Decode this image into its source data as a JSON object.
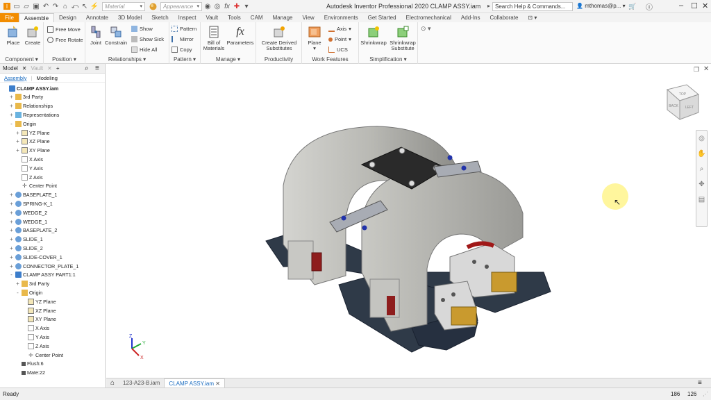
{
  "app": {
    "title": "Autodesk Inventor Professional 2020   CLAMP ASSY.iam",
    "search_placeholder": "Search Help & Commands...",
    "user": "mthomas@p...",
    "material_placeholder": "Material",
    "appearance_placeholder": "Appearance"
  },
  "tabs": [
    "File",
    "Assemble",
    "Design",
    "Annotate",
    "3D Model",
    "Sketch",
    "Inspect",
    "Vault",
    "Tools",
    "CAM",
    "Manage",
    "View",
    "Environments",
    "Get Started",
    "Electromechanical",
    "Add-Ins",
    "Collaborate"
  ],
  "active_tab": "Assemble",
  "ribbon": {
    "component": {
      "label": "Component",
      "place": "Place",
      "create": "Create"
    },
    "position": {
      "label": "Position",
      "free_move": "Free Move",
      "free_rotate": "Free Rotate"
    },
    "relationships": {
      "label": "Relationships",
      "joint": "Joint",
      "constrain": "Constrain",
      "show": "Show",
      "show_sick": "Show Sick",
      "hide_all": "Hide All"
    },
    "pattern": {
      "label": "Pattern",
      "pattern": "Pattern",
      "mirror": "Mirror",
      "copy": "Copy"
    },
    "manage": {
      "label": "Manage",
      "bom_line1": "Bill of",
      "bom_line2": "Materials",
      "parameters": "Parameters"
    },
    "productivity": {
      "label": "Productivity",
      "cds_line1": "Create Derived",
      "cds_line2": "Substitutes"
    },
    "work_features": {
      "label": "Work Features",
      "plane": "Plane",
      "axis": "Axis",
      "point": "Point",
      "ucs": "UCS"
    },
    "simplification": {
      "label": "Simplification",
      "shrinkwrap": "Shrinkwrap",
      "sws_line1": "Shrinkwrap",
      "sws_line2": "Substitute"
    }
  },
  "browser": {
    "tab_model": "Model",
    "tab_vault": "Vault",
    "sub_assembly": "Assembly",
    "sub_modeling": "Modeling",
    "items": [
      {
        "label": "CLAMP ASSY.iam",
        "depth": 0,
        "icon": "asm",
        "exp": "",
        "bold": true
      },
      {
        "label": "3rd Party",
        "depth": 1,
        "icon": "fld",
        "exp": "+"
      },
      {
        "label": "Relationships",
        "depth": 1,
        "icon": "fld",
        "exp": "+"
      },
      {
        "label": "Representations",
        "depth": 1,
        "icon": "rep",
        "exp": "+"
      },
      {
        "label": "Origin",
        "depth": 1,
        "icon": "fld",
        "exp": "-"
      },
      {
        "label": "YZ Plane",
        "depth": 2,
        "icon": "pln",
        "exp": "+"
      },
      {
        "label": "XZ Plane",
        "depth": 2,
        "icon": "pln",
        "exp": "+"
      },
      {
        "label": "XY Plane",
        "depth": 2,
        "icon": "pln",
        "exp": "+"
      },
      {
        "label": "X Axis",
        "depth": 2,
        "icon": "axs",
        "exp": ""
      },
      {
        "label": "Y Axis",
        "depth": 2,
        "icon": "axs",
        "exp": ""
      },
      {
        "label": "Z Axis",
        "depth": 2,
        "icon": "axs",
        "exp": ""
      },
      {
        "label": "Center Point",
        "depth": 2,
        "icon": "pt",
        "exp": ""
      },
      {
        "label": "BASEPLATE_1",
        "depth": 1,
        "icon": "part",
        "exp": "+"
      },
      {
        "label": "SPRING-K_1",
        "depth": 1,
        "icon": "part",
        "exp": "+"
      },
      {
        "label": "WEDGE_2",
        "depth": 1,
        "icon": "part",
        "exp": "+"
      },
      {
        "label": "WEDGE_1",
        "depth": 1,
        "icon": "part",
        "exp": "+"
      },
      {
        "label": "BASEPLATE_2",
        "depth": 1,
        "icon": "part",
        "exp": "+"
      },
      {
        "label": "SLIDE_1",
        "depth": 1,
        "icon": "part",
        "exp": "+"
      },
      {
        "label": "SLIDE_2",
        "depth": 1,
        "icon": "part",
        "exp": "+"
      },
      {
        "label": "SLIDE-COVER_1",
        "depth": 1,
        "icon": "part",
        "exp": "+"
      },
      {
        "label": "CONNECTOR_PLATE_1",
        "depth": 1,
        "icon": "part",
        "exp": "+"
      },
      {
        "label": "CLAMP ASSY PART1:1",
        "depth": 1,
        "icon": "asm",
        "exp": "-"
      },
      {
        "label": "3rd Party",
        "depth": 2,
        "icon": "fld",
        "exp": "+"
      },
      {
        "label": "Origin",
        "depth": 2,
        "icon": "fld",
        "exp": "-"
      },
      {
        "label": "YZ Plane",
        "depth": 3,
        "icon": "pln",
        "exp": ""
      },
      {
        "label": "XZ Plane",
        "depth": 3,
        "icon": "pln",
        "exp": ""
      },
      {
        "label": "XY Plane",
        "depth": 3,
        "icon": "pln",
        "exp": ""
      },
      {
        "label": "X Axis",
        "depth": 3,
        "icon": "axs",
        "exp": ""
      },
      {
        "label": "Y Axis",
        "depth": 3,
        "icon": "axs",
        "exp": ""
      },
      {
        "label": "Z Axis",
        "depth": 3,
        "icon": "axs",
        "exp": ""
      },
      {
        "label": "Center Point",
        "depth": 3,
        "icon": "pt",
        "exp": ""
      },
      {
        "label": "Flush:6",
        "depth": 2,
        "icon": "flush",
        "exp": ""
      },
      {
        "label": "Mate:22",
        "depth": 2,
        "icon": "flush",
        "exp": ""
      }
    ]
  },
  "viewcube": {
    "top": "TOP",
    "back": "BACK",
    "left": "LEFT"
  },
  "triad": {
    "x": "X",
    "y": "Y",
    "z": "Z"
  },
  "doc_tabs": [
    "123-A23-B.iam",
    "CLAMP ASSY.iam"
  ],
  "active_doc": "CLAMP ASSY.iam",
  "status": {
    "text": "Ready",
    "count1": "186",
    "count2": "126"
  },
  "colors": {
    "file_tab": "#f28c00",
    "accent": "#1a6cc0",
    "shell": "#b8b8b4",
    "base": "#2f3a48"
  }
}
